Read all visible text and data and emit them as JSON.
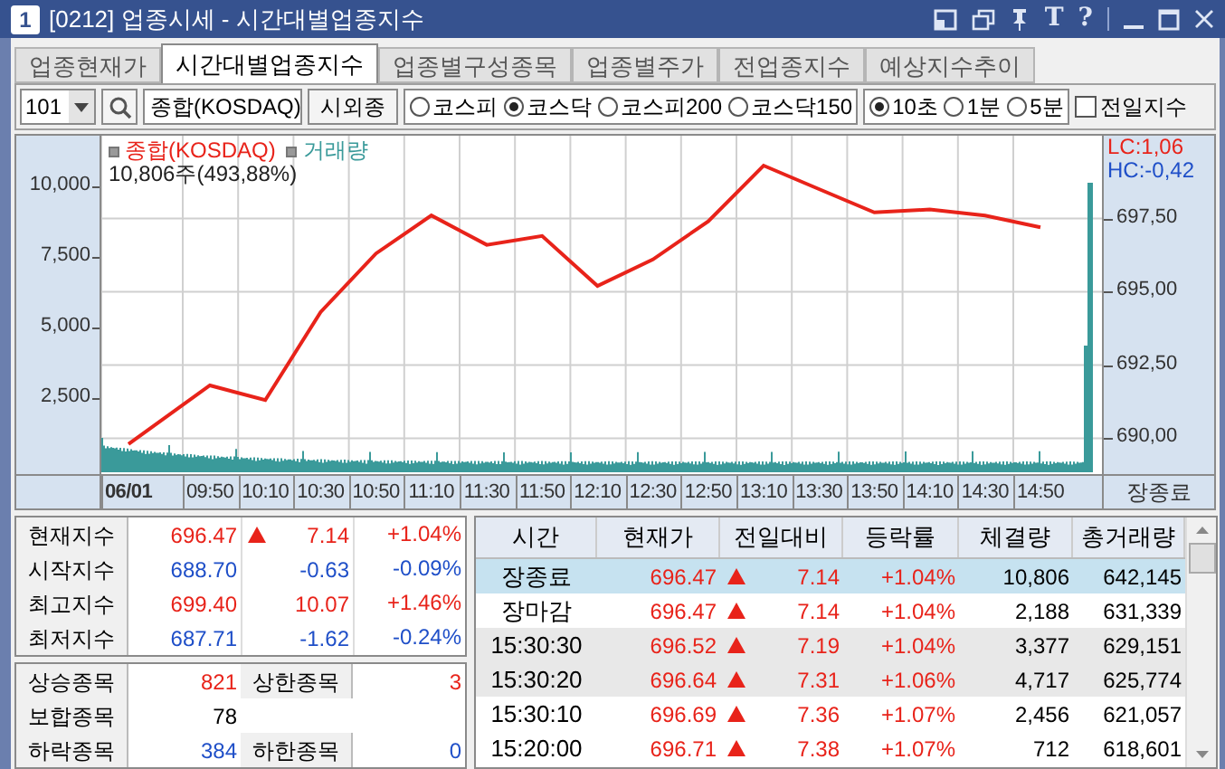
{
  "window": {
    "badge": "1",
    "title": "[0212] 업종시세 - 시간대별업종지수",
    "glyph_buttons": [
      "T",
      "?"
    ]
  },
  "tabs": [
    {
      "label": "업종현재가",
      "selected": false
    },
    {
      "label": "시간대별업종지수",
      "selected": true
    },
    {
      "label": "업종별구성종목",
      "selected": false
    },
    {
      "label": "업종별주가",
      "selected": false
    },
    {
      "label": "전업종지수",
      "selected": false
    },
    {
      "label": "예상지수추이",
      "selected": false
    }
  ],
  "toolbar": {
    "code": "101",
    "index_name": "종합(KOSDAQ)",
    "button": "시외종",
    "markets": [
      {
        "label": "코스피",
        "selected": false
      },
      {
        "label": "코스닥",
        "selected": true
      },
      {
        "label": "코스피200",
        "selected": false
      },
      {
        "label": "코스닥150",
        "selected": false
      }
    ],
    "intervals": [
      {
        "label": "10초",
        "selected": true
      },
      {
        "label": "1분",
        "selected": false
      },
      {
        "label": "5분",
        "selected": false
      }
    ],
    "prev_day_checkbox": {
      "label": "전일지수",
      "checked": false
    }
  },
  "chart": {
    "volume_legend": {
      "label": "거래량",
      "color": "#3a9a9a"
    },
    "info": "10,806주(493,88%)",
    "lc": "LC:1,06",
    "hc": "HC:-0,42",
    "volume_ticks": [
      "10,000",
      "7,500",
      "5,000",
      "2,500"
    ],
    "corner_label": "장종료",
    "chart_data": {
      "type": "line",
      "categories": [
        "06/01",
        "09:50",
        "10:10",
        "10:30",
        "10:50",
        "11:10",
        "11:30",
        "11:50",
        "12:10",
        "12:30",
        "12:50",
        "13:10",
        "13:30",
        "13:50",
        "14:10",
        "14:30",
        "14:50"
      ],
      "series": [
        {
          "name": "종합(KOSDAQ)",
          "color": "#e8231a",
          "values": [
            689.8,
            691.8,
            691.3,
            694.3,
            696.3,
            697.6,
            696.6,
            696.9,
            695.2,
            696.1,
            697.4,
            699.3,
            698.5,
            697.7,
            697.8,
            697.6,
            697.2
          ]
        }
      ],
      "grid": true,
      "ylim": [
        688.84,
        700.32
      ],
      "yticks": [
        {
          "value": 690,
          "label": "690,00"
        },
        {
          "value": 692.5,
          "label": "692,50"
        },
        {
          "value": 695,
          "label": "695,00"
        },
        {
          "value": 697.5,
          "label": "697,50"
        }
      ]
    }
  },
  "summary": [
    {
      "label": "현재지수",
      "value": "696.47",
      "arrow": true,
      "color": "#e8231a",
      "change": "7.14",
      "rate": "+1.04%"
    },
    {
      "label": "시작지수",
      "value": "688.70",
      "arrow": false,
      "color": "#1f4fc8",
      "change": "-0.63",
      "rate": "-0.09%"
    },
    {
      "label": "최고지수",
      "value": "699.40",
      "arrow": false,
      "color": "#e8231a",
      "change": "10.07",
      "rate": "+1.46%"
    },
    {
      "label": "최저지수",
      "value": "687.71",
      "arrow": false,
      "color": "#1f4fc8",
      "change": "-1.62",
      "rate": "-0.24%"
    }
  ],
  "breadth": [
    [
      {
        "label": "상승종목",
        "value": "821",
        "color": "#e8231a"
      },
      {
        "label": "상한종목",
        "value": "3",
        "color": "#e8231a"
      }
    ],
    [
      {
        "label": "보합종목",
        "value": "78",
        "color": "#000000"
      }
    ],
    [
      {
        "label": "하락종목",
        "value": "384",
        "color": "#1f4fc8"
      },
      {
        "label": "하한종목",
        "value": "0",
        "color": "#1f4fc8"
      }
    ]
  ],
  "table": {
    "columns": [
      "시간",
      "현재가",
      "전일대비",
      "등락률",
      "체결량",
      "총거래량"
    ],
    "rows": [
      {
        "time": "장종료",
        "price": "696.47",
        "arrow": true,
        "change": "7.14",
        "rate": "+1.04%",
        "volume": "10,806",
        "total": "642,145",
        "selected": true,
        "shaded": false
      },
      {
        "time": "장마감",
        "price": "696.47",
        "arrow": true,
        "change": "7.14",
        "rate": "+1.04%",
        "volume": "2,188",
        "total": "631,339",
        "selected": false,
        "shaded": false
      },
      {
        "time": "15:30:30",
        "price": "696.52",
        "arrow": true,
        "change": "7.19",
        "rate": "+1.04%",
        "volume": "3,377",
        "total": "629,151",
        "selected": false,
        "shaded": true
      },
      {
        "time": "15:30:20",
        "price": "696.64",
        "arrow": true,
        "change": "7.31",
        "rate": "+1.06%",
        "volume": "4,717",
        "total": "625,774",
        "selected": false,
        "shaded": true
      },
      {
        "time": "15:30:10",
        "price": "696.69",
        "arrow": true,
        "change": "7.36",
        "rate": "+1.07%",
        "volume": "2,456",
        "total": "621,057",
        "selected": false,
        "shaded": false
      },
      {
        "time": "15:20:00",
        "price": "696.71",
        "arrow": true,
        "change": "7.38",
        "rate": "+1.07%",
        "volume": "712",
        "total": "618,601",
        "selected": false,
        "shaded": false
      }
    ]
  }
}
